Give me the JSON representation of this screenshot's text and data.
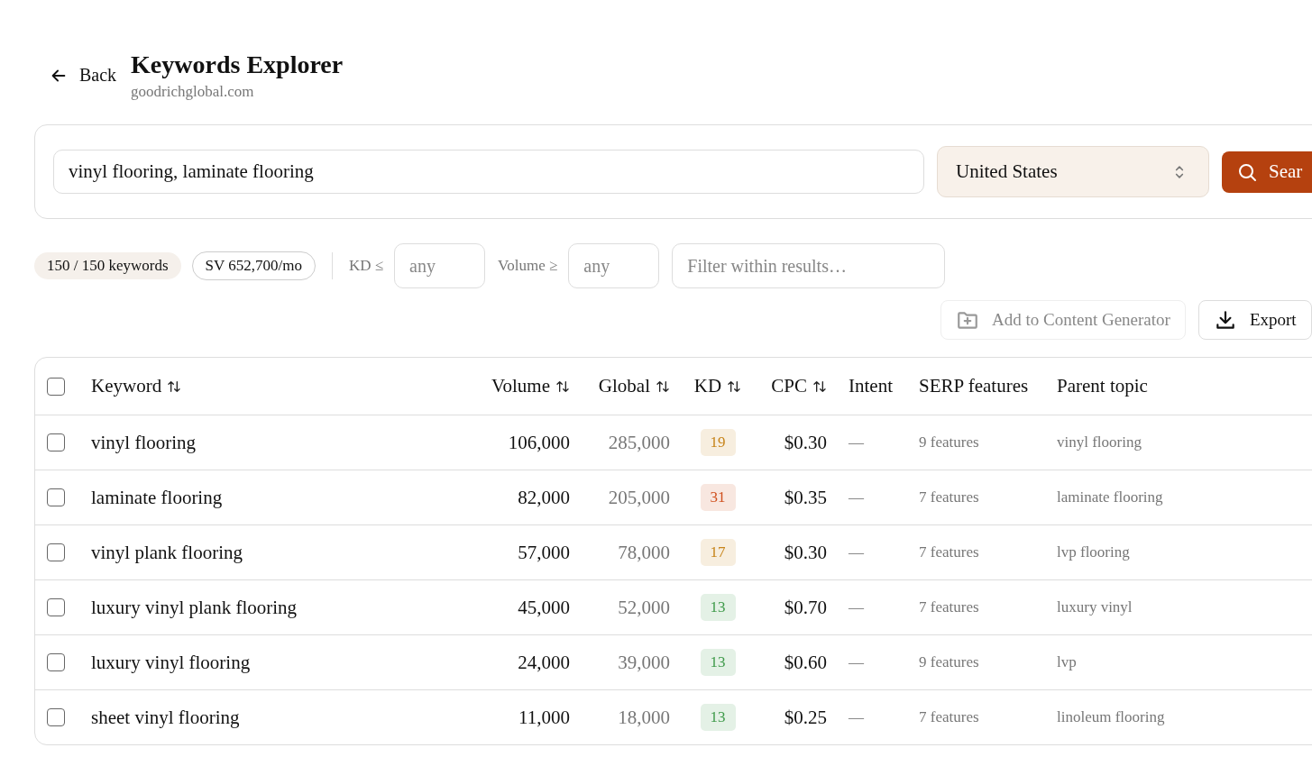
{
  "header": {
    "back_label": "Back",
    "title": "Keywords Explorer",
    "subtitle": "goodrichglobal.com"
  },
  "search": {
    "query": "vinyl flooring, laminate flooring",
    "country": "United States",
    "button": "Sear"
  },
  "summary": {
    "count": "150 / 150 keywords",
    "volume": "SV 652,700/mo"
  },
  "filters": [
    {
      "label": "KD ≤",
      "placeholder": "any"
    },
    {
      "label": "Volume ≥",
      "placeholder": "any"
    }
  ],
  "filter_search": {
    "placeholder": "Filter within results…"
  },
  "actions": [
    {
      "label": "Add to Content Generator",
      "kind": "add",
      "disabled": true
    },
    {
      "label": "Export",
      "kind": "export",
      "disabled": false
    }
  ],
  "table": {
    "select_all_checked": false,
    "columns": [
      {
        "label": "Keyword",
        "sortable": true,
        "kind": "text"
      },
      {
        "label": "Volume",
        "sortable": true,
        "kind": "number"
      },
      {
        "label": "Global",
        "sortable": true,
        "kind": "number"
      },
      {
        "label": "KD",
        "sortable": true,
        "kind": "badge"
      },
      {
        "label": "CPC",
        "sortable": true,
        "kind": "number"
      },
      {
        "label": "Intent",
        "sortable": false,
        "kind": "text"
      },
      {
        "label": "SERP features",
        "sortable": false,
        "kind": "text"
      },
      {
        "label": "Parent topic",
        "sortable": false,
        "kind": "text"
      }
    ],
    "rows": [
      {
        "checked": false,
        "keyword": "vinyl flooring",
        "volume": "106,000",
        "global": "285,000",
        "kd": "19",
        "color": "#c7841a",
        "cpc": "$0.30",
        "intent": "—",
        "serp": "9 features",
        "parent": "vinyl flooring"
      },
      {
        "checked": false,
        "keyword": "laminate flooring",
        "volume": "82,000",
        "global": "205,000",
        "kd": "31",
        "color": "#d0501e",
        "cpc": "$0.35",
        "intent": "—",
        "serp": "7 features",
        "parent": "laminate flooring"
      },
      {
        "checked": false,
        "keyword": "vinyl plank flooring",
        "volume": "57,000",
        "global": "78,000",
        "kd": "17",
        "color": "#c7841a",
        "cpc": "$0.30",
        "intent": "—",
        "serp": "7 features",
        "parent": "lvp flooring"
      },
      {
        "checked": false,
        "keyword": "luxury vinyl plank flooring",
        "volume": "45,000",
        "global": "52,000",
        "kd": "13",
        "color": "#3f9a4a",
        "cpc": "$0.70",
        "intent": "—",
        "serp": "7 features",
        "parent": "luxury vinyl"
      },
      {
        "checked": false,
        "keyword": "luxury vinyl flooring",
        "volume": "24,000",
        "global": "39,000",
        "kd": "13",
        "color": "#3f9a4a",
        "cpc": "$0.60",
        "intent": "—",
        "serp": "9 features",
        "parent": "lvp"
      },
      {
        "checked": false,
        "keyword": "sheet vinyl flooring",
        "volume": "11,000",
        "global": "18,000",
        "kd": "13",
        "color": "#3f9a4a",
        "cpc": "$0.25",
        "intent": "—",
        "serp": "7 features",
        "parent": "linoleum flooring"
      }
    ]
  }
}
